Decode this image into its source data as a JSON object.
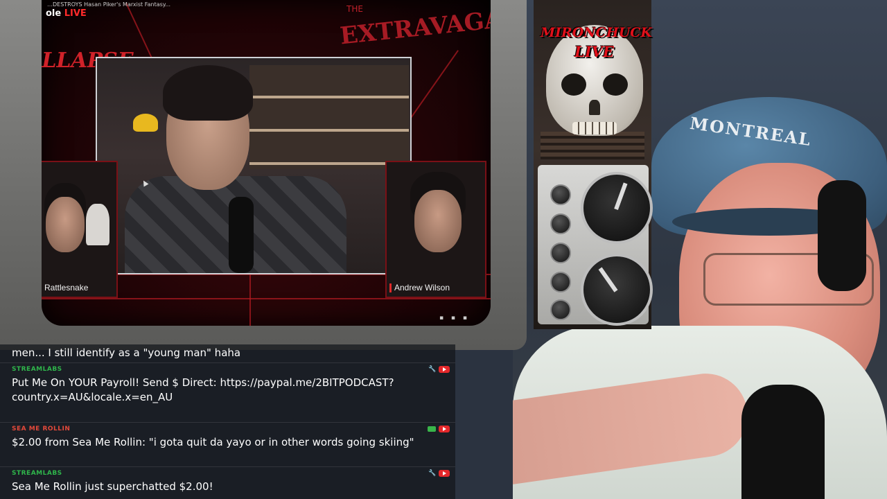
{
  "stream_window": {
    "video_title": "…DESTROYS Hasan Piker's Marxist Fantasy...",
    "channel_logo_prefix": "ole",
    "channel_logo_live": "LIVE",
    "left_banner_word": "LLAPSE",
    "banner_the": "THE",
    "banner_word": "EXTRAVAGANZA",
    "participants": [
      {
        "name": "Rattlesnake"
      },
      {
        "name": "Andrew Wilson"
      }
    ]
  },
  "logo": {
    "line1": "MIRONCHUCK",
    "line2": "LIVE"
  },
  "webcam": {
    "cap_text": "MONTREAL"
  },
  "chat": {
    "partial_line": "men... I still identify as a \"young man\" haha",
    "messages": [
      {
        "author": "STREAMLABS",
        "author_color": "#2fb54b",
        "text": "Put Me On YOUR Payroll! Send $ Direct: https://paypal.me/2BITPODCAST?country.x=AU&locale.x=en_AU",
        "icons": [
          "wrench-icon",
          "youtube-icon"
        ]
      },
      {
        "author": "SEA ME ROLLIN",
        "author_color": "#e5493a",
        "text": "$2.00 from Sea Me Rollin: \"i gota quit da yayo or in other words going skiing\"",
        "icons": [
          "money-icon",
          "youtube-icon"
        ]
      },
      {
        "author": "STREAMLABS",
        "author_color": "#2fb54b",
        "text": "Sea Me Rollin just superchatted $2.00!",
        "icons": [
          "wrench-icon",
          "youtube-icon"
        ]
      }
    ]
  },
  "colors": {
    "accent_red": "#d02229",
    "chat_bg": "rgba(20,22,26,0.72)"
  }
}
